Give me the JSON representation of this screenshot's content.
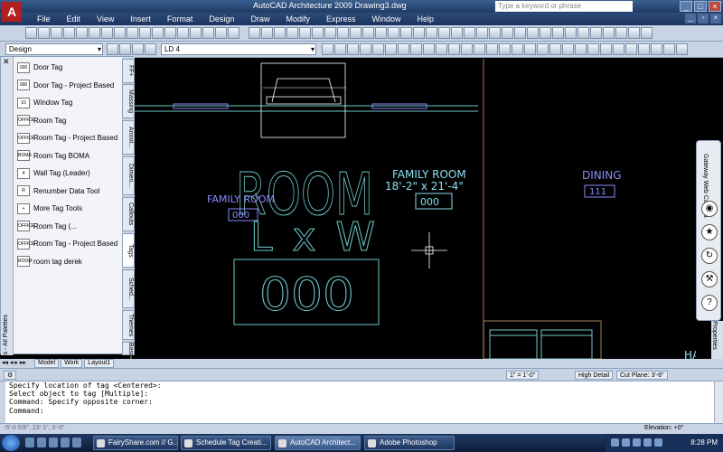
{
  "window": {
    "title": "AutoCAD Architecture 2009 Drawing3.dwg",
    "search_placeholder": "Type a keyword or phrase"
  },
  "menu": [
    "File",
    "Edit",
    "View",
    "Insert",
    "Format",
    "Design",
    "Draw",
    "Modify",
    "Express",
    "Window",
    "Help"
  ],
  "toolbar": {
    "workspace": "Design",
    "layer": "LD 4"
  },
  "palette": {
    "title": "Tool Palettes - All Palettes",
    "items": [
      {
        "label": "Door Tag",
        "icon": "000"
      },
      {
        "label": "Door Tag - Project Based",
        "icon": "000"
      },
      {
        "label": "Window Tag",
        "icon": "10"
      },
      {
        "label": "Room Tag",
        "icon": "OFFICE"
      },
      {
        "label": "Room Tag - Project Based",
        "icon": "OFFICE"
      },
      {
        "label": "Room Tag BOMA",
        "icon": "BOMA"
      },
      {
        "label": "Wall Tag (Leader)",
        "icon": "4"
      },
      {
        "label": "Renumber Data Tool",
        "icon": "R"
      },
      {
        "label": "More Tag Tools",
        "icon": "+"
      },
      {
        "label": "Room Tag (...",
        "icon": "OFFICE"
      },
      {
        "label": "Room Tag - Project Based",
        "icon": "OFFICE"
      },
      {
        "label": "room tag derek",
        "icon": "ROOM"
      }
    ],
    "tabs": [
      "FF+",
      "Massing",
      "Annot...",
      "Dimen...",
      "Callouts",
      "Tags",
      "Sched...",
      "Themes",
      "Basic"
    ],
    "active_tab": "Tags"
  },
  "drawing": {
    "big_room": "ROOM",
    "big_lxw": "L x W",
    "big_tag": "000",
    "family_left": "FAMILY ROOM",
    "family_left_tag": "000",
    "family_mid": "FAMILY ROOM",
    "family_mid_dims": "18'-2\" x 21'-4\"",
    "family_mid_tag": "000",
    "dining": "DINING",
    "dining_tag": "111",
    "hall": "HALL"
  },
  "gateway": {
    "label": "Gateway Web Camera"
  },
  "right_strip": "Properties",
  "layout_tabs": [
    "Model",
    "Work",
    "Layout1"
  ],
  "status1": {
    "scale": "1\" = 1'-0\"",
    "detail": "High Detail",
    "cutplane": "Cut Plane: 3'-6\""
  },
  "command": [
    "Specify location of tag <Centered>:",
    "Select object to tag [Multiple]:",
    "Command: Specify opposite corner:",
    "Command:"
  ],
  "status2": {
    "coords": "-5'-0 5/8\", 23'-1\", 0'-0\"",
    "elevation": "Elevation: +0\""
  },
  "taskbar": {
    "tasks": [
      "FairyShare.com // G...",
      "Schedule Tag Creati...",
      "AutoCAD Architect...",
      "Adobe Photoshop"
    ],
    "active_task": "AutoCAD Architect...",
    "clock": "8:28 PM"
  },
  "colors": {
    "cad_line": "#6ec8c8",
    "cad_text_blue": "#8a8aff",
    "cad_text_cyan": "#8ae0f0",
    "wall": "#c8a070"
  }
}
